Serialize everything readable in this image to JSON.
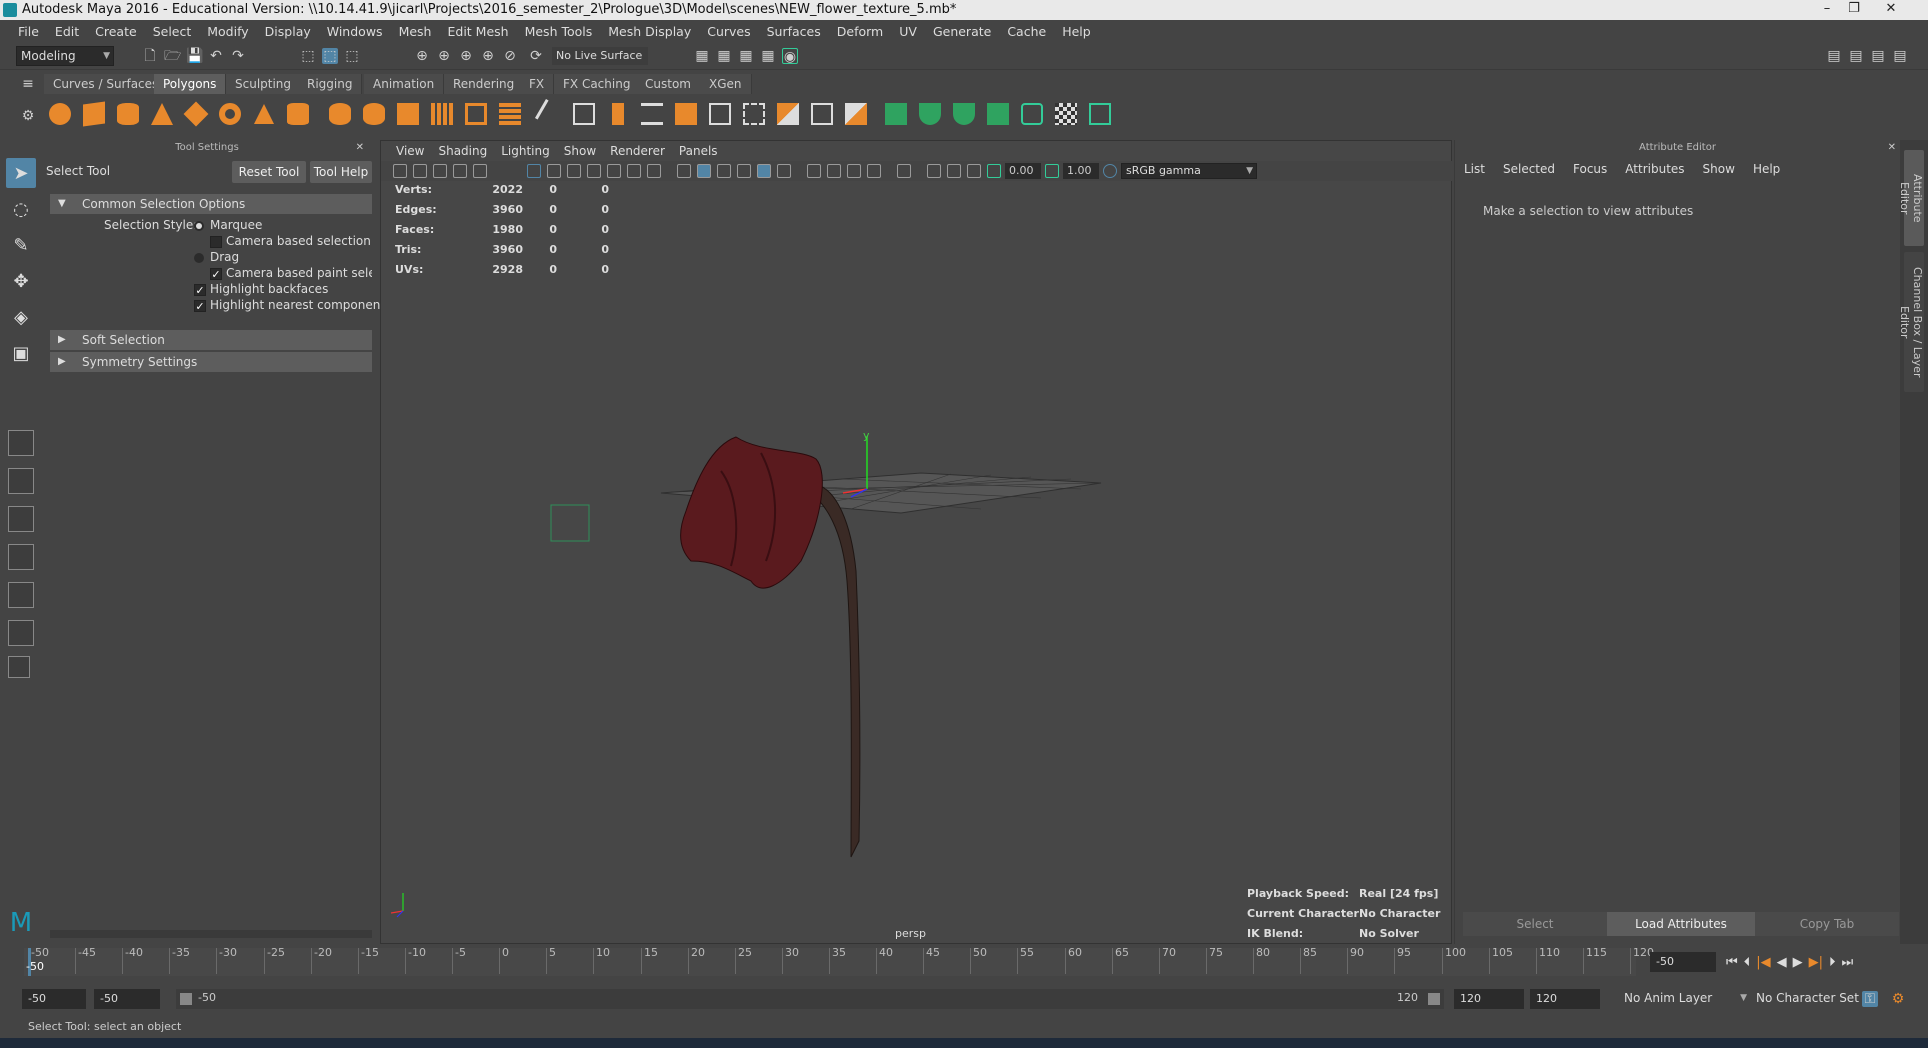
{
  "title_bar": {
    "title": "Autodesk Maya 2016 - Educational Version: \\\\10.14.41.9\\jicarl\\Projects\\2016_semester_2\\Prologue\\3D\\Model\\scenes\\NEW_flower_texture_5.mb*"
  },
  "menu": [
    "File",
    "Edit",
    "Create",
    "Select",
    "Modify",
    "Display",
    "Windows",
    "Mesh",
    "Edit Mesh",
    "Mesh Tools",
    "Mesh Display",
    "Curves",
    "Surfaces",
    "Deform",
    "UV",
    "Generate",
    "Cache",
    "Help"
  ],
  "status_line": {
    "menu_set": "Modeling",
    "live_surface": "No Live Surface"
  },
  "shelf_tabs": [
    "Curves / Surfaces",
    "Polygons",
    "Sculpting",
    "Rigging",
    "Animation",
    "Rendering",
    "FX",
    "FX Caching",
    "Custom",
    "XGen"
  ],
  "shelf_active": "Polygons",
  "tool_settings": {
    "header": "Tool Settings",
    "tool_name": "Select Tool",
    "reset_label": "Reset Tool",
    "help_label": "Tool Help",
    "common_section": "Common Selection Options",
    "selection_style_label": "Selection Style:",
    "opt_marquee": "Marquee",
    "opt_camera_based": "Camera based selection",
    "opt_drag": "Drag",
    "opt_camera_paint": "Camera based paint selectio",
    "opt_backfaces": "Highlight backfaces",
    "opt_nearest": "Highlight nearest component",
    "soft_section": "Soft Selection",
    "symmetry_section": "Symmetry Settings"
  },
  "viewport": {
    "menu": [
      "View",
      "Shading",
      "Lighting",
      "Show",
      "Renderer",
      "Panels"
    ],
    "exposure": "0.00",
    "gamma": "1.00",
    "color_space": "sRGB gamma",
    "camera": "persp",
    "stats": [
      {
        "label": "Verts:",
        "v1": "2022",
        "v2": "0",
        "v3": "0"
      },
      {
        "label": "Edges:",
        "v1": "3960",
        "v2": "0",
        "v3": "0"
      },
      {
        "label": "Faces:",
        "v1": "1980",
        "v2": "0",
        "v3": "0"
      },
      {
        "label": "Tris:",
        "v1": "3960",
        "v2": "0",
        "v3": "0"
      },
      {
        "label": "UVs:",
        "v1": "2928",
        "v2": "0",
        "v3": "0"
      }
    ],
    "playback_label": "Playback Speed:",
    "playback_value": "Real [24 fps]",
    "character_label": "Current Character:",
    "character_value": "No Character",
    "ik_label": "IK Blend:",
    "ik_value": "No Solver",
    "axis_y": "y"
  },
  "attribute_editor": {
    "header": "Attribute Editor",
    "tabs": [
      "List",
      "Selected",
      "Focus",
      "Attributes",
      "Show",
      "Help"
    ],
    "message": "Make a selection to view attributes",
    "select_label": "Select",
    "load_label": "Load Attributes",
    "copy_label": "Copy Tab"
  },
  "side_tabs": {
    "attribute": "Attribute Editor",
    "channel": "Channel Box / Layer Editor"
  },
  "timeline": {
    "ticks": [
      "-50",
      "-45",
      "-40",
      "-35",
      "-30",
      "-25",
      "-20",
      "-15",
      "-10",
      "-5",
      "0",
      "5",
      "10",
      "15",
      "20",
      "25",
      "30",
      "35",
      "40",
      "45",
      "50",
      "55",
      "60",
      "65",
      "70",
      "75",
      "80",
      "85",
      "90",
      "95",
      "100",
      "105",
      "110",
      "115",
      "120"
    ],
    "current_frame": "-50",
    "current_field": "-50"
  },
  "range": {
    "start": "-50",
    "anim_start": "-50",
    "slider_start": "-50",
    "slider_end": "120",
    "anim_end": "120",
    "end": "120",
    "anim_layer": "No Anim Layer",
    "char_set": "No Character Set"
  },
  "help_line": "Select Tool: select an object",
  "colors": {
    "accent": "#5285a6",
    "bg": "#444444",
    "viewport": "#474747",
    "petal": "#5a1a1e",
    "stem": "#3a2a25"
  }
}
